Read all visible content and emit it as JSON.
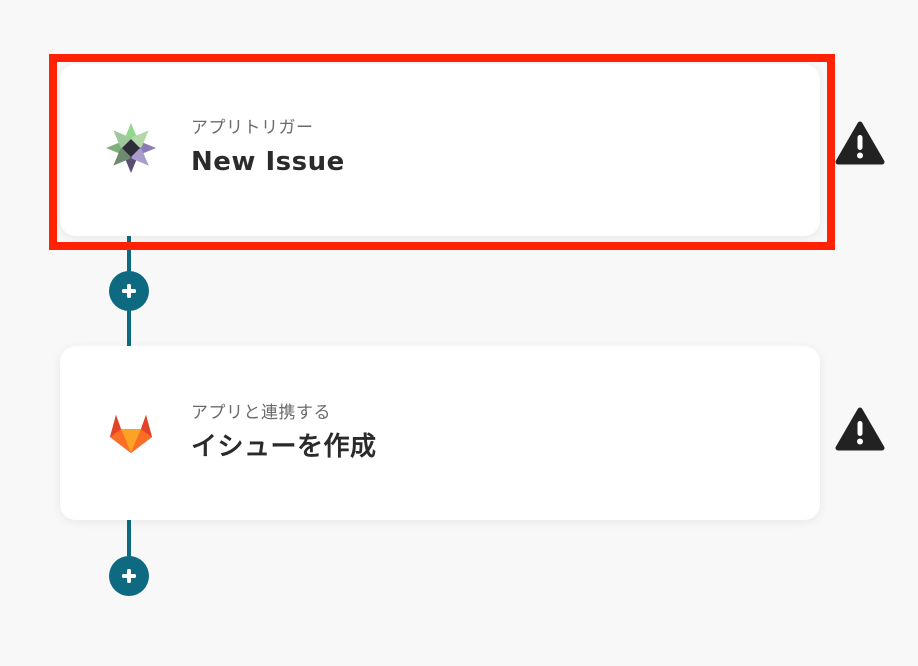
{
  "steps": [
    {
      "subtitle": "アプリトリガー",
      "title": "New Issue",
      "app_icon": "multi-color-star-logo",
      "status_icon": "warning-icon"
    },
    {
      "subtitle": "アプリと連携する",
      "title": "イシューを作成",
      "app_icon": "gitlab-logo",
      "status_icon": "warning-icon"
    }
  ],
  "add_step_button_icon": "plus-icon",
  "colors": {
    "connector": "#0e6a80",
    "highlight": "#ff2205",
    "warning": "#222222",
    "background": "#f8f8f8"
  }
}
